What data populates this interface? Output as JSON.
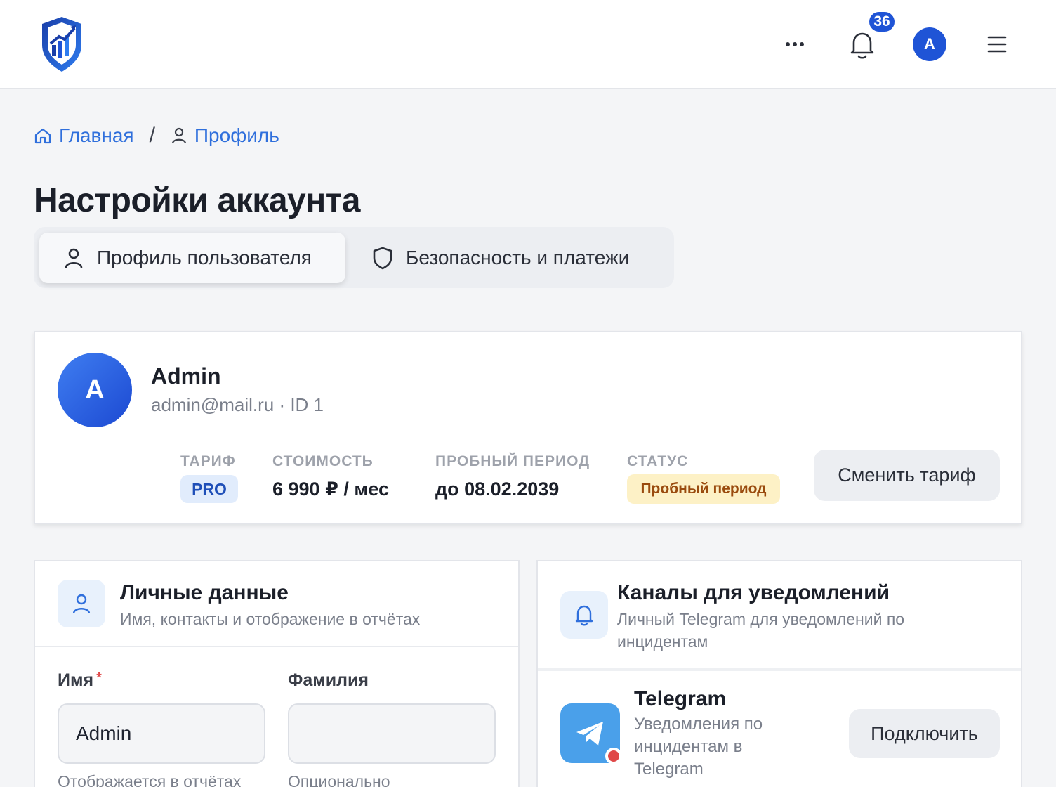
{
  "header": {
    "notifications_count": "36",
    "avatar_letter": "A"
  },
  "breadcrumb": {
    "home": "Главная",
    "separator": "/",
    "profile": "Профиль"
  },
  "page": {
    "title": "Настройки аккаунта"
  },
  "tabs": [
    {
      "label": "Профиль пользователя",
      "active": true,
      "icon": "user-icon"
    },
    {
      "label": "Безопасность и платежи",
      "active": false,
      "icon": "shield-icon"
    }
  ],
  "profile": {
    "avatar_letter": "A",
    "name": "Admin",
    "subtitle": "admin@mail.ru · ID 1",
    "stats": {
      "tariff_label": "ТАРИФ",
      "tariff_value": "PRO",
      "cost_label": "СТОИМОСТЬ",
      "cost_value": "6 990 ₽ / мес",
      "trial_label": "ПРОБНЫЙ ПЕРИОД",
      "trial_value": "до 08.02.2039",
      "status_label": "СТАТУС",
      "status_value": "Пробный период"
    },
    "change_tariff_label": "Сменить тариф"
  },
  "personal": {
    "title": "Личные данные",
    "description": "Имя, контакты и отображение в отчётах",
    "first_name_label": "Имя",
    "required_mark": "*",
    "first_name_value": "Admin",
    "first_name_hint": "Отображается в отчётах",
    "last_name_label": "Фамилия",
    "last_name_value": "",
    "last_name_hint": "Опционально"
  },
  "channels": {
    "title": "Каналы для уведомлений",
    "description": "Личный Telegram для уведомлений по инцидентам",
    "telegram": {
      "title": "Telegram",
      "description": "Уведомления по инцидентам в Telegram",
      "connect_label": "Подключить"
    }
  },
  "colors": {
    "brand": "#1f54d6",
    "link": "#2f6fdc",
    "status_error": "#e04848",
    "telegram": "#4aa0ea"
  }
}
